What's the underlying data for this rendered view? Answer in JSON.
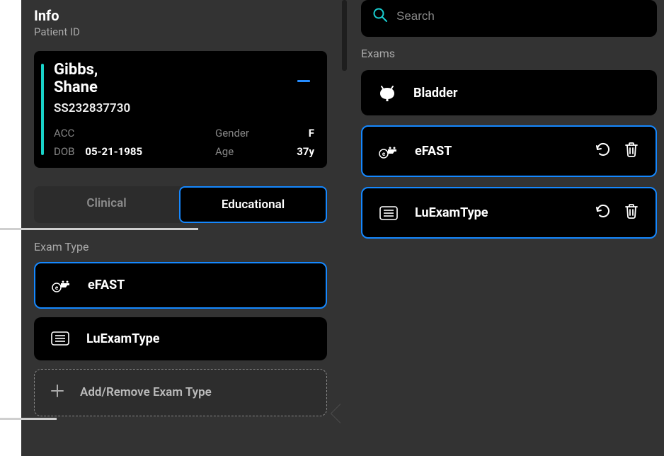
{
  "left": {
    "heading": "Info",
    "sub_label": "Patient ID",
    "patient": {
      "name_line1": "Gibbs,",
      "name_line2": "Shane",
      "id": "SS232837730",
      "acc_label": "ACC",
      "acc_value": "",
      "gender_label": "Gender",
      "gender_value": "F",
      "dob_label": "DOB",
      "dob_value": "05-21-1985",
      "age_label": "Age",
      "age_value": "37y"
    },
    "segmented": {
      "clinical": "Clinical",
      "educational": "Educational",
      "selected": "educational"
    },
    "exam_type_label": "Exam Type",
    "exam_types": [
      {
        "label": "eFAST",
        "icon": "ambulance-e-icon",
        "selected": true
      },
      {
        "label": "LuExamType",
        "icon": "list-box-icon",
        "selected": false
      }
    ],
    "add_remove_label": "Add/Remove Exam Type"
  },
  "right": {
    "search_placeholder": "Search",
    "exams_label": "Exams",
    "exams": [
      {
        "label": "Bladder",
        "icon": "bladder-icon",
        "selected": false,
        "actions": false
      },
      {
        "label": "eFAST",
        "icon": "ambulance-e-icon",
        "selected": true,
        "actions": true
      },
      {
        "label": "LuExamType",
        "icon": "list-box-icon",
        "selected": true,
        "actions": true
      }
    ]
  },
  "colors": {
    "accent_blue": "#1588ff",
    "teal": "#19d2c8",
    "search_cyan": "#19cfd2"
  }
}
